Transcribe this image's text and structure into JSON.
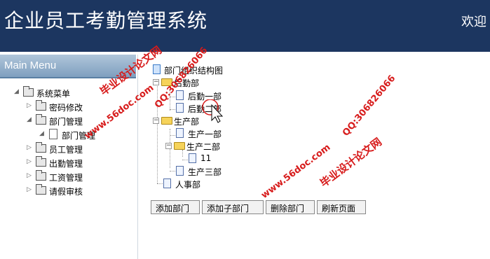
{
  "header": {
    "title": "企业员工考勤管理系统",
    "welcome": "欢迎"
  },
  "sidebar": {
    "title": "Main Menu",
    "root": "系统菜单",
    "items": [
      {
        "label": "密码修改"
      },
      {
        "label": "部门管理"
      },
      {
        "label": "部门管理"
      },
      {
        "label": "员工管理"
      },
      {
        "label": "出勤管理"
      },
      {
        "label": "工资管理"
      },
      {
        "label": "请假审核"
      }
    ]
  },
  "tree": {
    "root": "部门组织结构图",
    "nodes": [
      "后勤部",
      "后勤一部",
      "后勤二部",
      "生产部",
      "生产一部",
      "生产二部",
      "11",
      "生产三部",
      "人事部"
    ]
  },
  "buttons": {
    "add": "添加部门",
    "add_sub": "添加子部门",
    "delete": "删除部门",
    "refresh": "刷新页面"
  },
  "watermarks": {
    "text_site": "毕业设计论文网",
    "url": "www.56doc.com",
    "qq": "QQ:306826066"
  }
}
